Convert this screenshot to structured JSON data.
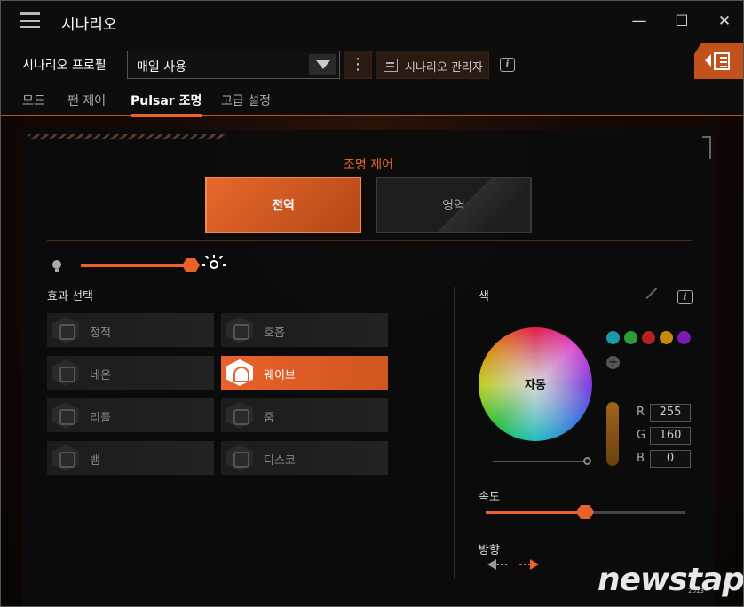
{
  "app": {
    "title": "시나리오"
  },
  "profile": {
    "label": "시나리오 프로필",
    "selected": "매일 사용",
    "more": "⋮",
    "manager_label": "시나리오 관리자",
    "info": "i"
  },
  "tabs": [
    {
      "label": "모드",
      "active": false
    },
    {
      "label": "팬 제어",
      "active": false
    },
    {
      "label": "Pulsar 조명",
      "active": true
    },
    {
      "label": "고급 설정",
      "active": false
    }
  ],
  "lighting": {
    "section_title": "조명 제어",
    "mode_global": "전역",
    "mode_zone": "영역",
    "brightness_level": 0.85,
    "effects_title": "효과 선택",
    "effects": [
      {
        "label": "정적",
        "icon": "static-cube-icon",
        "active": false
      },
      {
        "label": "호흡",
        "icon": "breathing-icon",
        "active": false
      },
      {
        "label": "네온",
        "icon": "neon-icon",
        "active": false
      },
      {
        "label": "웨이브",
        "icon": "wave-icon",
        "active": true
      },
      {
        "label": "리플",
        "icon": "ripple-icon",
        "active": false
      },
      {
        "label": "줌",
        "icon": "zoom-icon",
        "active": false
      },
      {
        "label": "뱀",
        "icon": "snake-icon",
        "active": false
      },
      {
        "label": "디스코",
        "icon": "disco-icon",
        "active": false
      }
    ]
  },
  "color": {
    "title": "색",
    "info": "i",
    "wheel_label": "자동",
    "swatches": [
      "#1a9aa8",
      "#2e9a3a",
      "#b8201e",
      "#c8880e",
      "#7a1ab0"
    ],
    "add_swatch": "+",
    "rgb": {
      "r_label": "R",
      "r": "255",
      "g_label": "G",
      "g": "160",
      "b_label": "B",
      "b": "0"
    }
  },
  "speed": {
    "title": "속도",
    "level": 0.5
  },
  "direction": {
    "title": "방향",
    "selected": "right"
  },
  "watermark": {
    "text": "newstap",
    "year": "2013"
  }
}
